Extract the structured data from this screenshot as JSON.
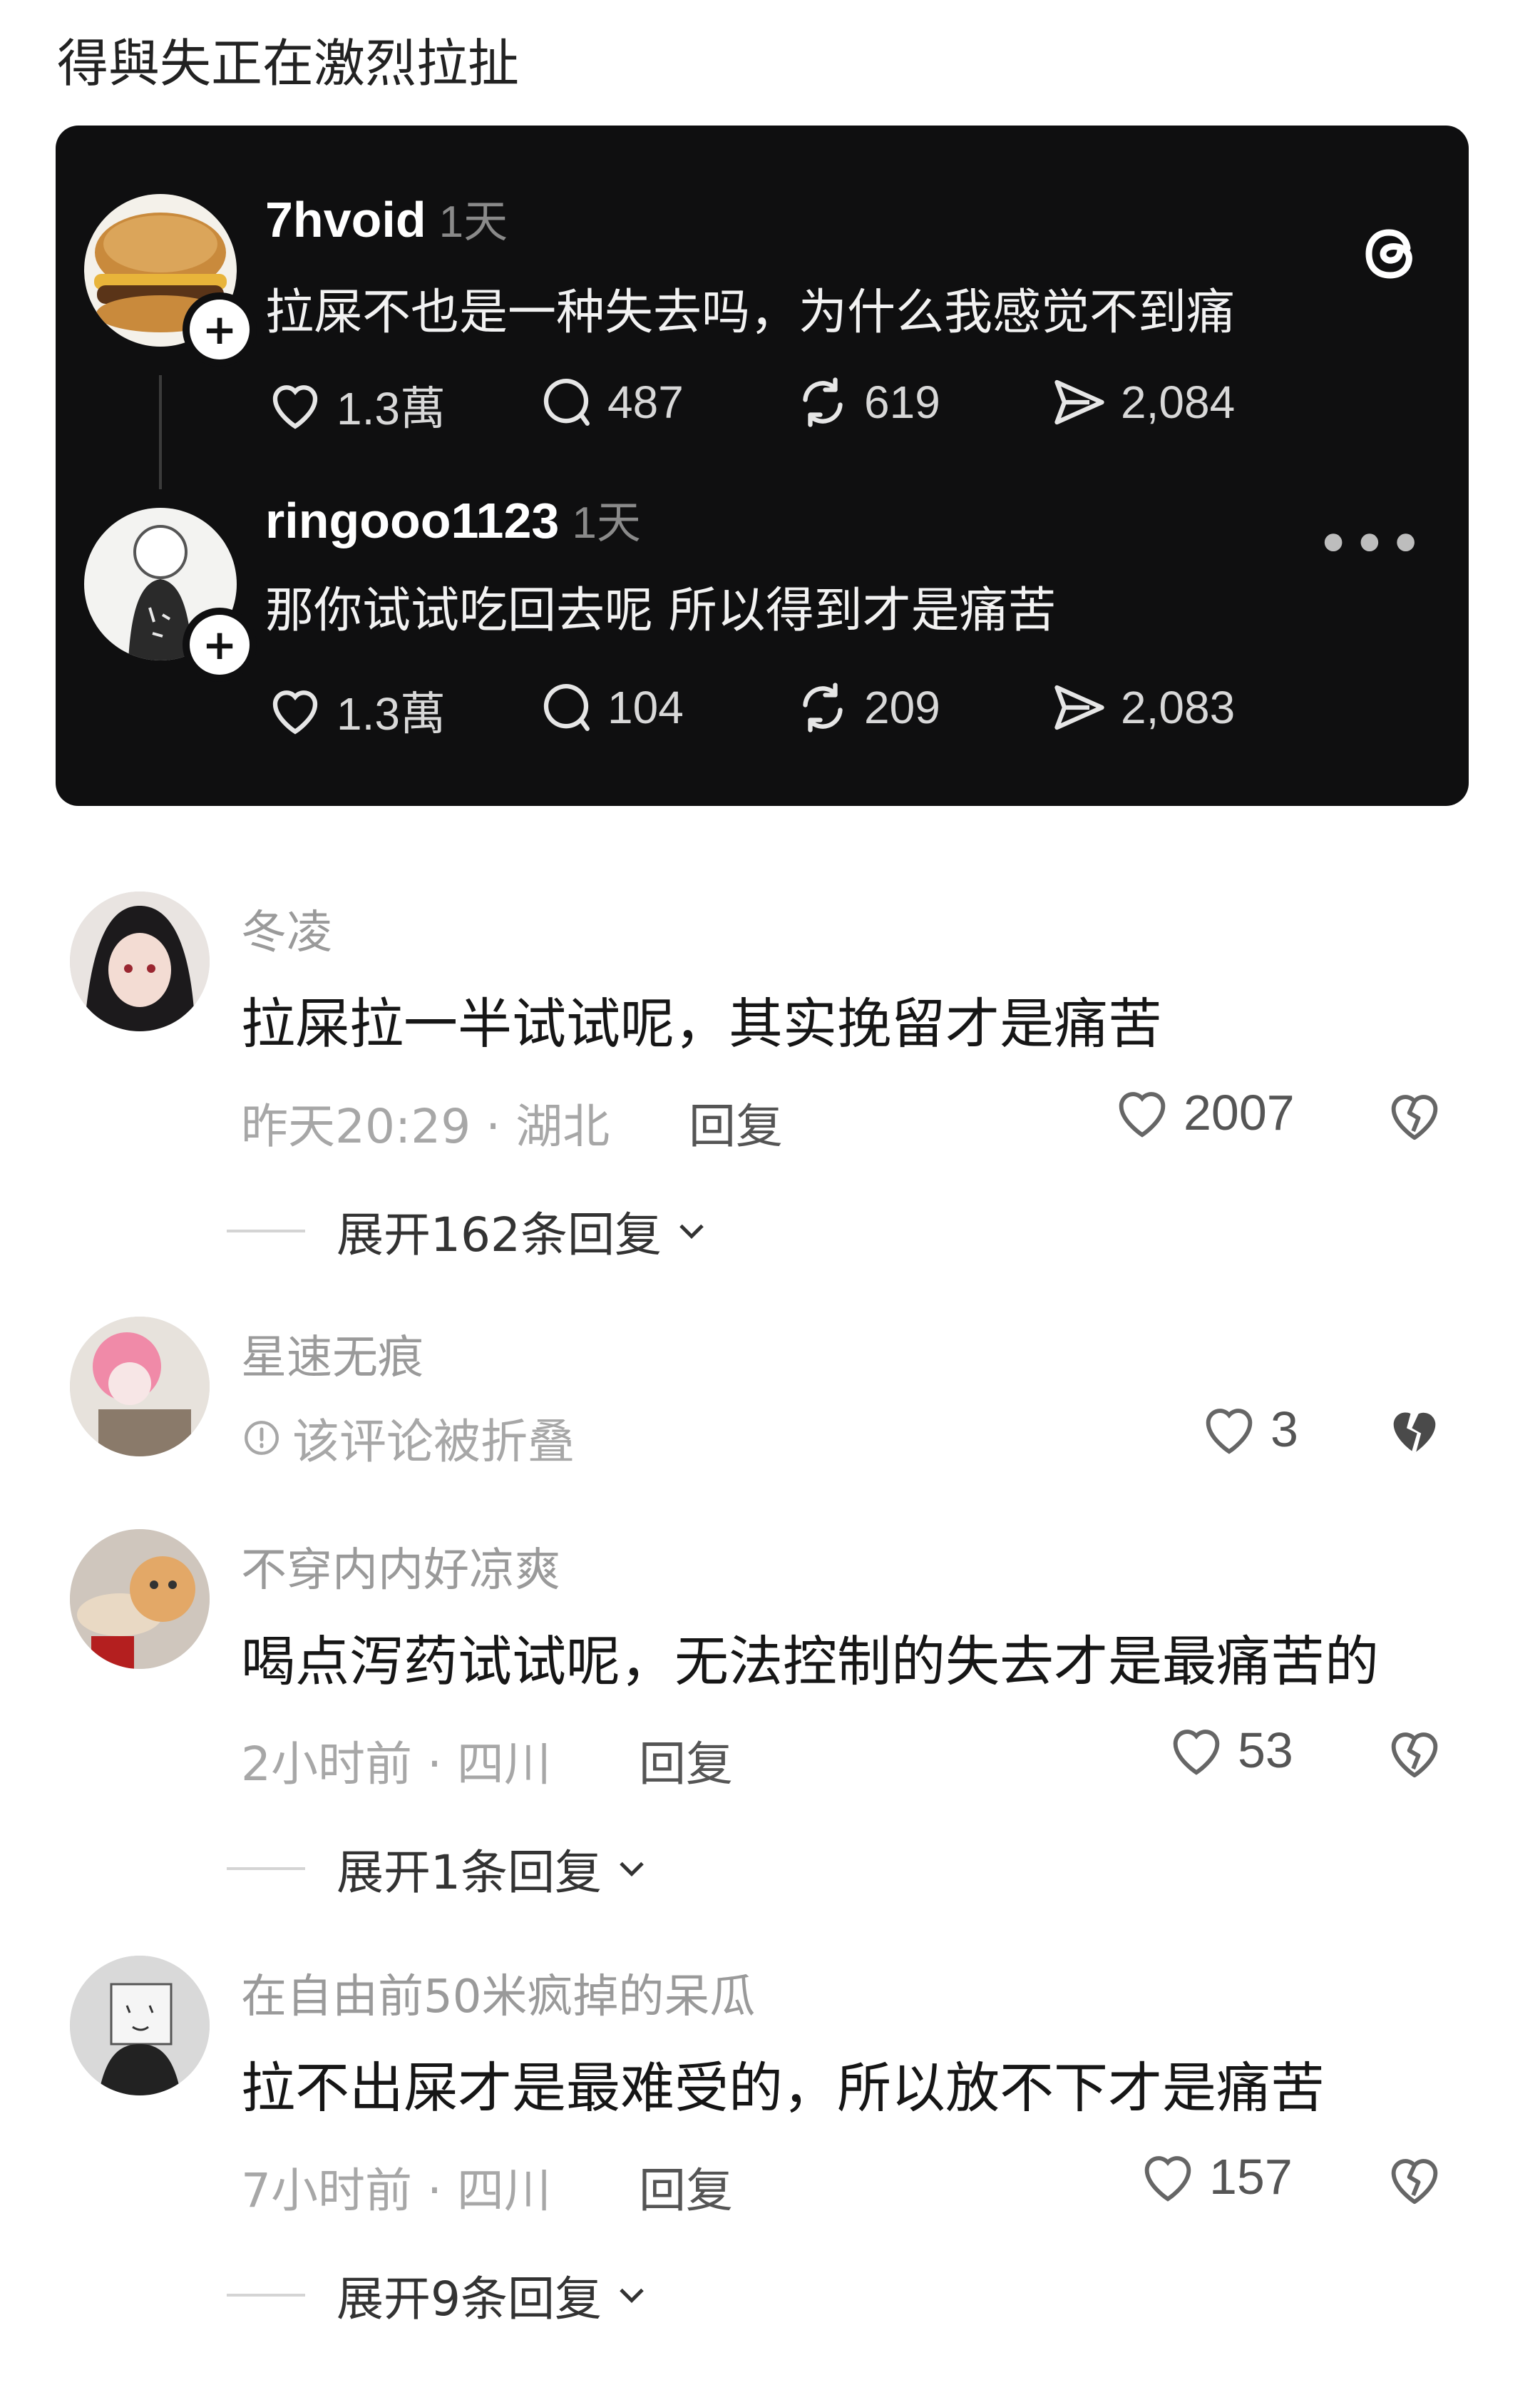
{
  "page": {
    "title": "得與失正在激烈拉扯"
  },
  "threads": {
    "posts": [
      {
        "username": "7hvoid",
        "time": "1天",
        "text": "拉屎不也是一种失去吗，为什么我感觉不到痛",
        "likes": "1.3萬",
        "replies": "487",
        "reposts": "619",
        "shares": "2,084",
        "avatar_icon": "burger-avatar"
      },
      {
        "username": "ringooo1123",
        "time": "1天",
        "text": "那你试试吃回去呢 所以得到才是痛苦",
        "likes": "1.3萬",
        "replies": "104",
        "reposts": "209",
        "shares": "2,083",
        "avatar_icon": "sketch-avatar"
      }
    ],
    "follow_symbol": "+",
    "more_symbol": "•••",
    "logo_icon": "threads-logo"
  },
  "comments": [
    {
      "name": "冬凌",
      "text": "拉屎拉一半试试呢，其实挽留才是痛苦",
      "time_location": "昨天20:29 · 湖北",
      "reply_label": "回复",
      "likes": "2007",
      "expand_label": "展开162条回复"
    },
    {
      "name": "星速无痕",
      "folded_text": "该评论被折叠",
      "likes": "3"
    },
    {
      "name": "不穿内内好凉爽",
      "text": "喝点泻药试试呢，无法控制的失去才是最痛苦的",
      "time_location": "2小时前 · 四川",
      "reply_label": "回复",
      "likes": "53",
      "expand_label": "展开1条回复"
    },
    {
      "name": "在自由前50米疯掉的呆瓜",
      "text": "拉不出屎才是最难受的，所以放不下才是痛苦",
      "time_location": "7小时前 · 四川",
      "reply_label": "回复",
      "likes": "157",
      "expand_label": "展开9条回复"
    }
  ],
  "colors": {
    "card_bg": "#0f0f10",
    "text_primary": "#161616",
    "text_secondary": "#a7a7a7"
  }
}
